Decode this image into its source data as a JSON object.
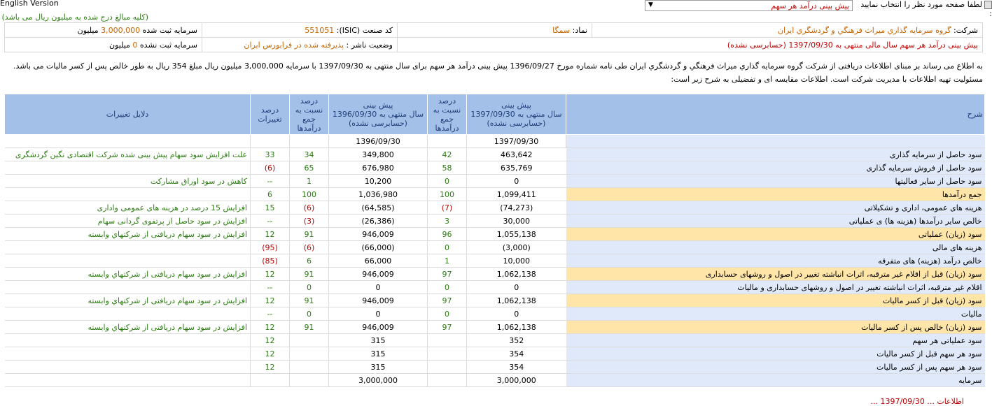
{
  "top": {
    "english_link": "English Version",
    "page_select_label": "لطفا صفحه مورد نظر را انتخاب نمایید :",
    "page_select_value": "پیش بینی درآمد هر سهم",
    "note": "(کلیه مبالغ درج شده به میلیون ریال می باشد)"
  },
  "info": {
    "company_label": "شرکت:",
    "company_value": "گروه سرمايه گذاري ميراث فرهنگي و گردشگري ايران",
    "symbol_label": "نماد:",
    "symbol_value": "سمگا",
    "isic_label": "کد صنعت (ISIC):",
    "isic_value": "551051",
    "capital_reg_label": "سرمایه ثبت شده",
    "capital_reg_value": "3,000,000",
    "capital_reg_unit": "میلیون",
    "forecast_label": "پیش بینی درآمد هر سهم سال مالی منتهی به",
    "forecast_date": "1397/09/30",
    "forecast_status": "(حسابرسی نشده)",
    "publisher_label": "وضعیت ناشر :",
    "publisher_value": "پذیرفته شده در فرابورس ایران",
    "capital_unreg_label": "سرمایه ثبت نشده",
    "capital_unreg_value": "0",
    "capital_unreg_unit": "میلیون"
  },
  "description": "به اطلاع می رساند بر مبنای اطلاعات دریافتی از شرکت گروه سرمايه گذاري ميراث فرهنگي و گردشگري ايران طی نامه شماره مورخ 1396/09/27 پیش بینی درآمد هر سهم برای سال منتهی به 1397/09/30 با سرمایه 3,000,000 میلیون ریال مبلغ 354 ریال به طور خالص پس از کسر مالیات می باشد. مسئولیت تهیه اطلاعات با مدیریت شرکت است. اطلاعات مقایسه ای و تفضیلی به شرح زیر است:",
  "table": {
    "headers": {
      "desc": "شرح",
      "f1_l1": "پیش بینی",
      "f1_l2": "سال منتهی به 1397/09/30",
      "f1_l3": "(حسابرسی نشده)",
      "p1_l1": "درصد",
      "p1_l2": "نسبت به",
      "p1_l3": "جمع",
      "p1_l4": "درآمدها",
      "f2_l1": "پیش بینی",
      "f2_l2": "سال منتهی به 1396/09/30",
      "f2_l3": "(حسابرسی نشده)",
      "p2_l1": "درصد",
      "p2_l2": "نسبت به",
      "p2_l3": "جمع",
      "p2_l4": "درآمدها",
      "c_l1": "درصد",
      "c_l2": "تغییرات",
      "reasons": "دلایل تغییرات"
    },
    "date1": "1397/09/30",
    "date2": "1396/09/30",
    "rows": [
      {
        "desc": "سود حاصل از سرمایه گذاری",
        "v1": "463,642",
        "p1": "42",
        "v2": "349,800",
        "p2": "34",
        "c": "33",
        "reason": "علت افزایش سود سهام پیش بینی شده شرکت  اقتصادی نگین گردشگری"
      },
      {
        "desc": "سود حاصل از فروش سرمایه گذاری",
        "v1": "635,769",
        "p1": "58",
        "v2": "676,980",
        "p2": "65",
        "c": "(6)",
        "reason": ""
      },
      {
        "desc": "سود حاصل از سایر فعالیتها",
        "v1": "0",
        "p1": "0",
        "v2": "10,200",
        "p2": "1",
        "c": "--",
        "reason": "کاهش در سود اوراق مشارکت"
      },
      {
        "desc": "جمع درآمدها",
        "v1": "1,099,411",
        "p1": "100",
        "v2": "1,036,980",
        "p2": "100",
        "c": "6",
        "reason": ""
      },
      {
        "desc": "هزینه های عمومی، اداری و تشکیلاتی",
        "v1": "(74,273)",
        "p1": "(7)",
        "v2": "(64,585)",
        "p2": "(6)",
        "c": "15",
        "reason": "افزایش 15 درصد در هزینه های عمومی واداری"
      },
      {
        "desc": "خالص سایر درآمدها (هزینه ها) ی عملیاتی",
        "v1": "30,000",
        "p1": "3",
        "v2": "(26,386)",
        "p2": "(3)",
        "c": "--",
        "reason": "افزایش در سود حاصل از پرتفوی گردانی سهام"
      },
      {
        "desc": "سود (زیان) عملیاتی",
        "v1": "1,055,138",
        "p1": "96",
        "v2": "946,009",
        "p2": "91",
        "c": "12",
        "reason": "افزایش در سود سهام دریافتی از شرکتهاي وابسته"
      },
      {
        "desc": "هزینه های مالی",
        "v1": "(3,000)",
        "p1": "0",
        "v2": "(66,000)",
        "p2": "(6)",
        "c": "(95)",
        "reason": ""
      },
      {
        "desc": "خالص درآمد (هزینه) های متفرقه",
        "v1": "10,000",
        "p1": "1",
        "v2": "66,000",
        "p2": "6",
        "c": "(85)",
        "reason": ""
      },
      {
        "desc": "سود (زیان) قبل از اقلام غیر مترقبه، اثرات انباشته تغییر در اصول و روشهای حسابداری",
        "v1": "1,062,138",
        "p1": "97",
        "v2": "946,009",
        "p2": "91",
        "c": "12",
        "reason": "افزایش در سود سهام دریافتی از شرکتهاي وابسته"
      },
      {
        "desc": "اقلام غیر مترقبه، اثرات انباشته تغییر در اصول و روشهای حسابداری و مالیات",
        "v1": "0",
        "p1": "0",
        "v2": "0",
        "p2": "0",
        "c": "--",
        "reason": ""
      },
      {
        "desc": "سود (زیان) قبل از کسر مالیات",
        "v1": "1,062,138",
        "p1": "97",
        "v2": "946,009",
        "p2": "91",
        "c": "12",
        "reason": "افزایش در سود سهام دریافتی از شرکتهاي وابسته"
      },
      {
        "desc": "مالیات",
        "v1": "0",
        "p1": "0",
        "v2": "0",
        "p2": "0",
        "c": "--",
        "reason": ""
      },
      {
        "desc": "سود (زیان) خالص پس از کسر مالیات",
        "v1": "1,062,138",
        "p1": "97",
        "v2": "946,009",
        "p2": "91",
        "c": "12",
        "reason": "افزایش در سود سهام دریافتی از شرکتهاي وابسته"
      },
      {
        "desc": "سود عملیاتی هر سهم",
        "v1": "352",
        "p1": "",
        "v2": "315",
        "p2": "",
        "c": "12",
        "reason": ""
      },
      {
        "desc": "سود هر سهم قبل از کسر مالیات",
        "v1": "354",
        "p1": "",
        "v2": "315",
        "p2": "",
        "c": "12",
        "reason": ""
      },
      {
        "desc": "سود هر سهم پس از کسر مالیات",
        "v1": "354",
        "p1": "",
        "v2": "315",
        "p2": "",
        "c": "12",
        "reason": ""
      },
      {
        "desc": "سرمایه",
        "v1": "3,000,000",
        "p1": "",
        "v2": "3,000,000",
        "p2": "",
        "c": "",
        "reason": ""
      }
    ]
  },
  "bottom_text": "اطلاعات ... 1397/09/30 ..."
}
